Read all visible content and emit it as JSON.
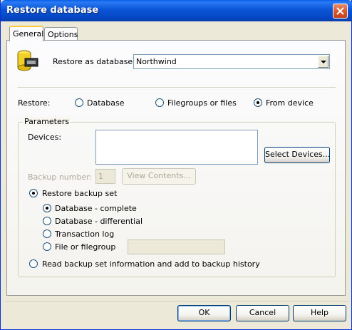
{
  "window": {
    "title": "Restore database"
  },
  "tabs": [
    {
      "label": "General",
      "active": true
    },
    {
      "label": "Options",
      "active": false
    }
  ],
  "general": {
    "restore_as_label": "Restore as database:",
    "restore_as_value": "Northwind",
    "restore_label": "Restore:",
    "restore_options": [
      {
        "label": "Database",
        "checked": false
      },
      {
        "label": "Filegroups or files",
        "checked": false
      },
      {
        "label": "From device",
        "checked": true
      }
    ]
  },
  "parameters": {
    "title": "Parameters",
    "devices_label": "Devices:",
    "select_devices_button": "Select Devices...",
    "backup_number_label": "Backup number:",
    "backup_number_value": "1",
    "view_contents_button": "View Contents...",
    "restore_backup_set_label": "Restore backup set",
    "backup_set_types": [
      {
        "label": "Database - complete",
        "checked": true
      },
      {
        "label": "Database - differential",
        "checked": false
      },
      {
        "label": "Transaction log",
        "checked": false
      },
      {
        "label": "File or filegroup",
        "checked": false
      }
    ],
    "file_or_filegroup_value": "",
    "read_info_label": "Read backup set information and add to backup history"
  },
  "buttons": {
    "ok": "OK",
    "cancel": "Cancel",
    "help": "Help"
  },
  "icons": {
    "database": "database-icon",
    "close": "close-icon"
  },
  "colors": {
    "titlebar": "#0a55d6",
    "dialog_bg": "#ece9d8",
    "close_button": "#d75a31",
    "active_tab_accent": "#ffc83c"
  }
}
